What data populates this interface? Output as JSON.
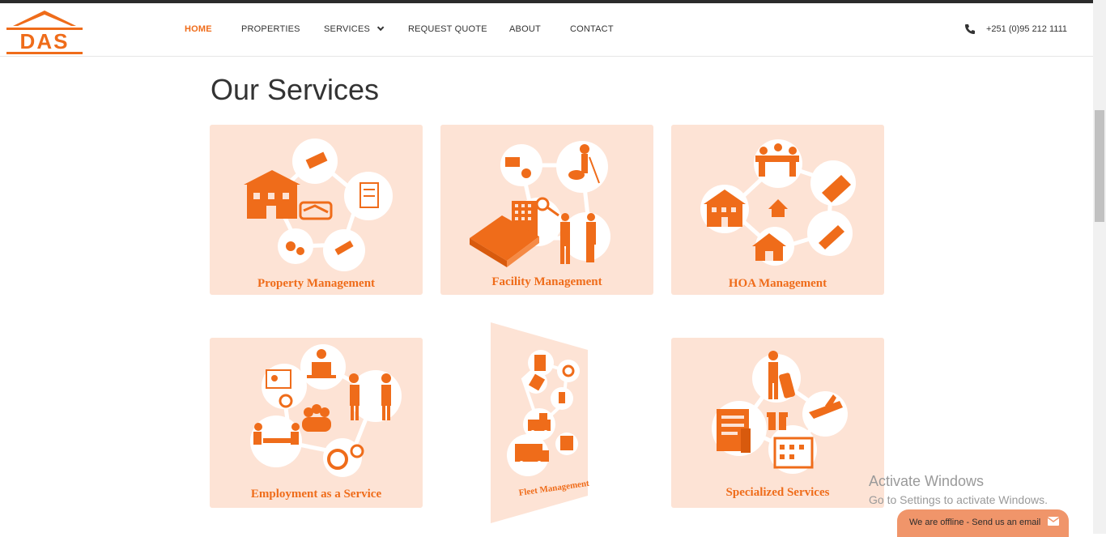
{
  "brand": {
    "logo_text": "DAS",
    "accent": "#ef6c1a",
    "card_bg": "#fde3d5"
  },
  "nav": {
    "home": "HOME",
    "properties": "PROPERTIES",
    "services": "SERVICES",
    "request_quote": "REQUEST QUOTE",
    "about": "ABOUT",
    "contact": "CONTACT"
  },
  "contact": {
    "phone_icon": "phone-icon",
    "phone": "+251 (0)95 212 1111"
  },
  "page": {
    "title": "Our Services"
  },
  "services": [
    {
      "title": "Property Management",
      "icon": "property-management-illustration"
    },
    {
      "title": "Facility Management",
      "icon": "facility-management-illustration"
    },
    {
      "title": "HOA Management",
      "icon": "hoa-management-illustration"
    },
    {
      "title": "Employment as a Service",
      "icon": "employment-illustration"
    },
    {
      "title": "Fleet Management",
      "icon": "fleet-management-illustration"
    },
    {
      "title": "Specialized Services",
      "icon": "specialized-services-illustration"
    }
  ],
  "watermark": {
    "line1": "Activate Windows",
    "line2": "Go to Settings to activate Windows."
  },
  "chat": {
    "label": "We are offline - Send us an email",
    "icon": "mail-icon"
  }
}
